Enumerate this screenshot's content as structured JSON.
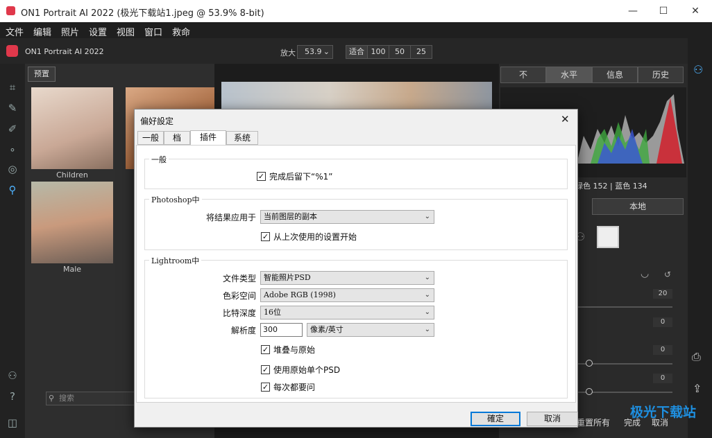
{
  "window": {
    "title": "ON1 Portrait AI 2022 (极光下载站1.jpeg @ 53.9% 8-bit)",
    "minimize": "—",
    "maximize": "☐",
    "close": "✕"
  },
  "menu": [
    "文件",
    "编辑",
    "照片",
    "设置",
    "视图",
    "窗口",
    "救命"
  ],
  "toolbar": {
    "app_name": "ON1 Portrait AI 2022",
    "zoom_label": "放大",
    "zoom_value": "53.9",
    "fit": "适合",
    "z100": "100",
    "z50": "50",
    "z25": "25"
  },
  "browser": {
    "preset_button": "预置",
    "thumbs": [
      {
        "caption": "Children"
      },
      {
        "caption": "Male"
      }
    ],
    "search_placeholder": "搜索"
  },
  "right": {
    "tabs": [
      "不",
      "水平",
      "信息",
      "历史"
    ],
    "color_readout": "绿色 152 | 蓝色 134",
    "local_tab": "本地",
    "values": [
      "20",
      "0",
      "0",
      "0"
    ],
    "reset_all": "重置所有",
    "done": "完成",
    "cancel": "取消"
  },
  "dialog": {
    "title": "偏好設定",
    "tabs": [
      "一般",
      "档",
      "插件",
      "系统"
    ],
    "general": {
      "group": "一般",
      "keep_after": "完成后留下“%1”"
    },
    "photoshop": {
      "group": "Photoshop中",
      "apply_label": "将结果应用于",
      "apply_value": "当前图层的副本",
      "start_last": "从上次使用的设置开始"
    },
    "lightroom": {
      "group": "Lightroom中",
      "filetype_label": "文件类型",
      "filetype_value": "智能照片PSD",
      "colorspace_label": "色彩空间",
      "colorspace_value": "Adobe RGB (1998)",
      "bitdepth_label": "比特深度",
      "bitdepth_value": "16位",
      "resolution_label": "解析度",
      "resolution_value": "300",
      "resolution_unit": "像素/英寸",
      "stack": "堆叠与原始",
      "use_single_psd": "使用原始单个PSD",
      "ask_every": "每次都要问"
    },
    "ok": "確定",
    "cancel": "取消"
  },
  "watermark": "极光下载站"
}
